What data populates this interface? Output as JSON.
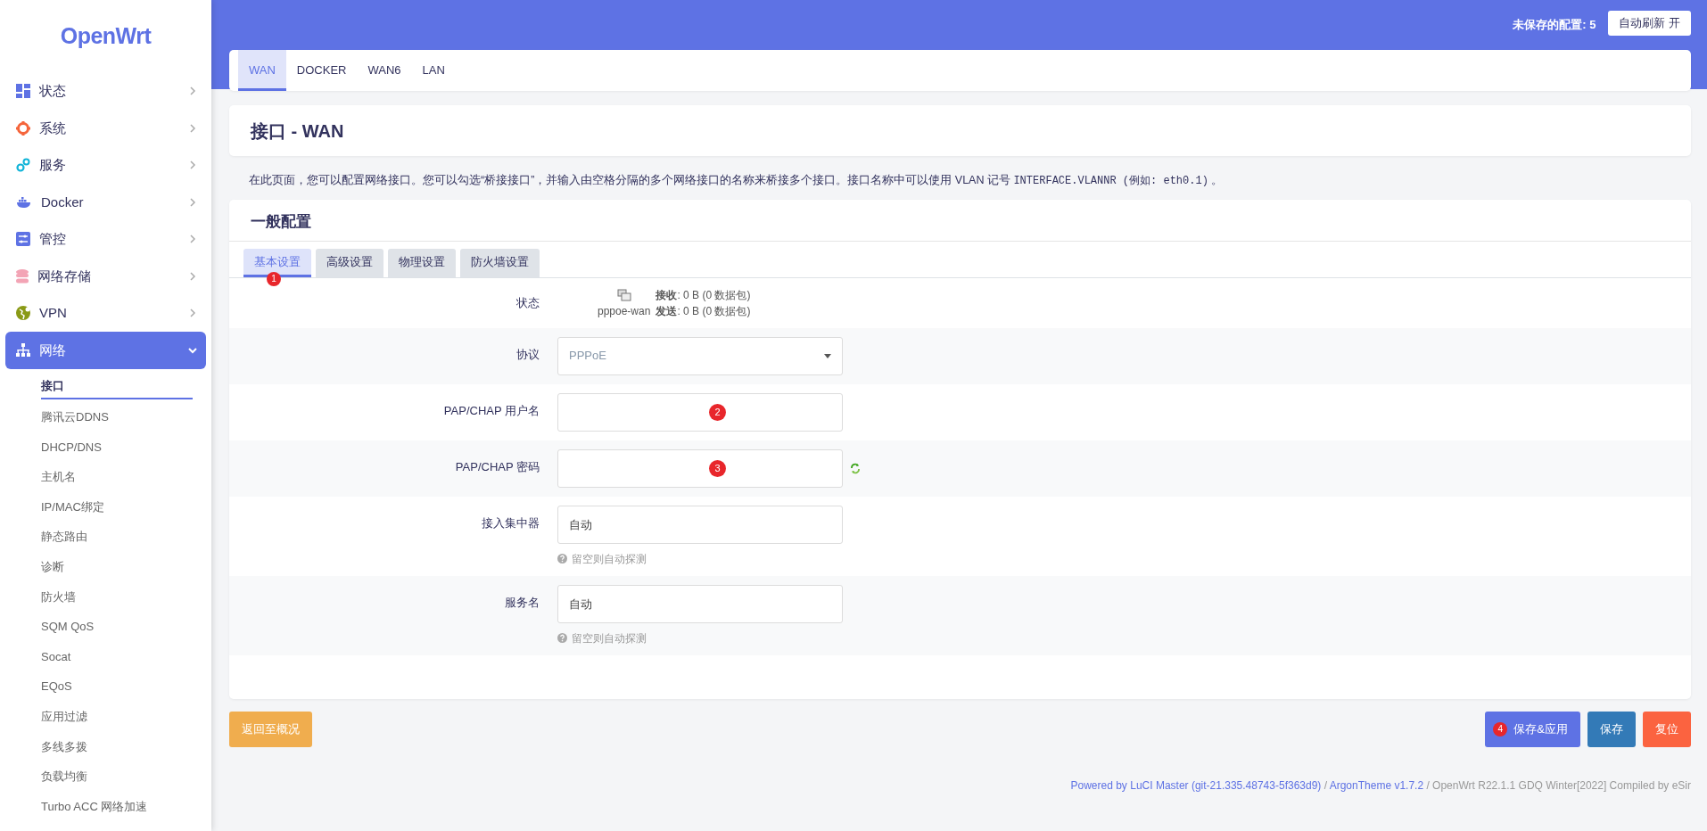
{
  "brand": "OpenWrt",
  "header": {
    "unsaved": "未保存的配置: 5",
    "refresh_button": "自动刷新 开"
  },
  "sidebar": {
    "items": [
      {
        "label": "状态",
        "selected": false,
        "expanded": false
      },
      {
        "label": "系统",
        "selected": false,
        "expanded": false
      },
      {
        "label": "服务",
        "selected": false,
        "expanded": false
      },
      {
        "label": "Docker",
        "selected": false,
        "expanded": false
      },
      {
        "label": "管控",
        "selected": false,
        "expanded": false
      },
      {
        "label": "网络存储",
        "selected": false,
        "expanded": false
      },
      {
        "label": "VPN",
        "selected": false,
        "expanded": false
      },
      {
        "label": "网络",
        "selected": true,
        "expanded": true,
        "children": [
          {
            "label": "接口",
            "selected": true
          },
          {
            "label": "腾讯云DDNS",
            "selected": false
          },
          {
            "label": "DHCP/DNS",
            "selected": false
          },
          {
            "label": "主机名",
            "selected": false
          },
          {
            "label": "IP/MAC绑定",
            "selected": false
          },
          {
            "label": "静态路由",
            "selected": false
          },
          {
            "label": "诊断",
            "selected": false
          },
          {
            "label": "防火墙",
            "selected": false
          },
          {
            "label": "SQM QoS",
            "selected": false
          },
          {
            "label": "Socat",
            "selected": false
          },
          {
            "label": "EQoS",
            "selected": false
          },
          {
            "label": "应用过滤",
            "selected": false
          },
          {
            "label": "多线多拨",
            "selected": false
          },
          {
            "label": "负载均衡",
            "selected": false
          },
          {
            "label": "Turbo ACC 网络加速",
            "selected": false
          }
        ]
      }
    ]
  },
  "interface_tabs": [
    {
      "label": "WAN",
      "selected": true
    },
    {
      "label": "DOCKER",
      "selected": false
    },
    {
      "label": "WAN6",
      "selected": false
    },
    {
      "label": "LAN",
      "selected": false
    }
  ],
  "page_title": "接口 - WAN",
  "description": {
    "text": "在此页面，您可以配置网络接口。您可以勾选“桥接接口”，并输入由空格分隔的多个网络接口的名称来桥接多个接口。接口名称中可以使用",
    "link": "VLAN",
    "middle": "记号",
    "code": "INTERFACE.VLANNR (例如: eth0.1)",
    "end": "。"
  },
  "section": {
    "title": "一般配置",
    "tabs": [
      {
        "label": "基本设置",
        "selected": true,
        "marker": "1"
      },
      {
        "label": "高级设置",
        "selected": false
      },
      {
        "label": "物理设置",
        "selected": false
      },
      {
        "label": "防火墙设置",
        "selected": false
      }
    ],
    "rows": [
      {
        "kind": "status",
        "label": "状态",
        "device": "pppoe-wan",
        "rx": "**接收**: 0 B (0 数据包)",
        "tx": "**发送**: 0 B (0 数据包)"
      },
      {
        "kind": "select",
        "label": "协议",
        "value": "PPPoE"
      },
      {
        "kind": "text",
        "label": "PAP/CHAP 用户名",
        "marker": "2"
      },
      {
        "kind": "password",
        "label": "PAP/CHAP 密码",
        "marker": "3"
      },
      {
        "kind": "text",
        "label": "接入集中器",
        "placeholder": "自动",
        "help": "留空则自动探测"
      },
      {
        "kind": "text",
        "label": "服务名",
        "placeholder": "自动",
        "help": "留空则自动探测"
      }
    ]
  },
  "actions": {
    "back": "返回至概况",
    "buttons": [
      {
        "label": "保存&应用",
        "kind": "apply",
        "marker": "4"
      },
      {
        "label": "保存",
        "kind": "save"
      },
      {
        "label": "复位",
        "kind": "reset"
      }
    ]
  },
  "footer": {
    "luci_link": "Powered by LuCI Master (git-21.335.48743-5f363d9)",
    "separator": "/",
    "theme_link": "ArgonTheme v1.7.2",
    "build": "/ OpenWrt R22.1.1 GDQ Winter[2022] Compiled by eSir"
  }
}
